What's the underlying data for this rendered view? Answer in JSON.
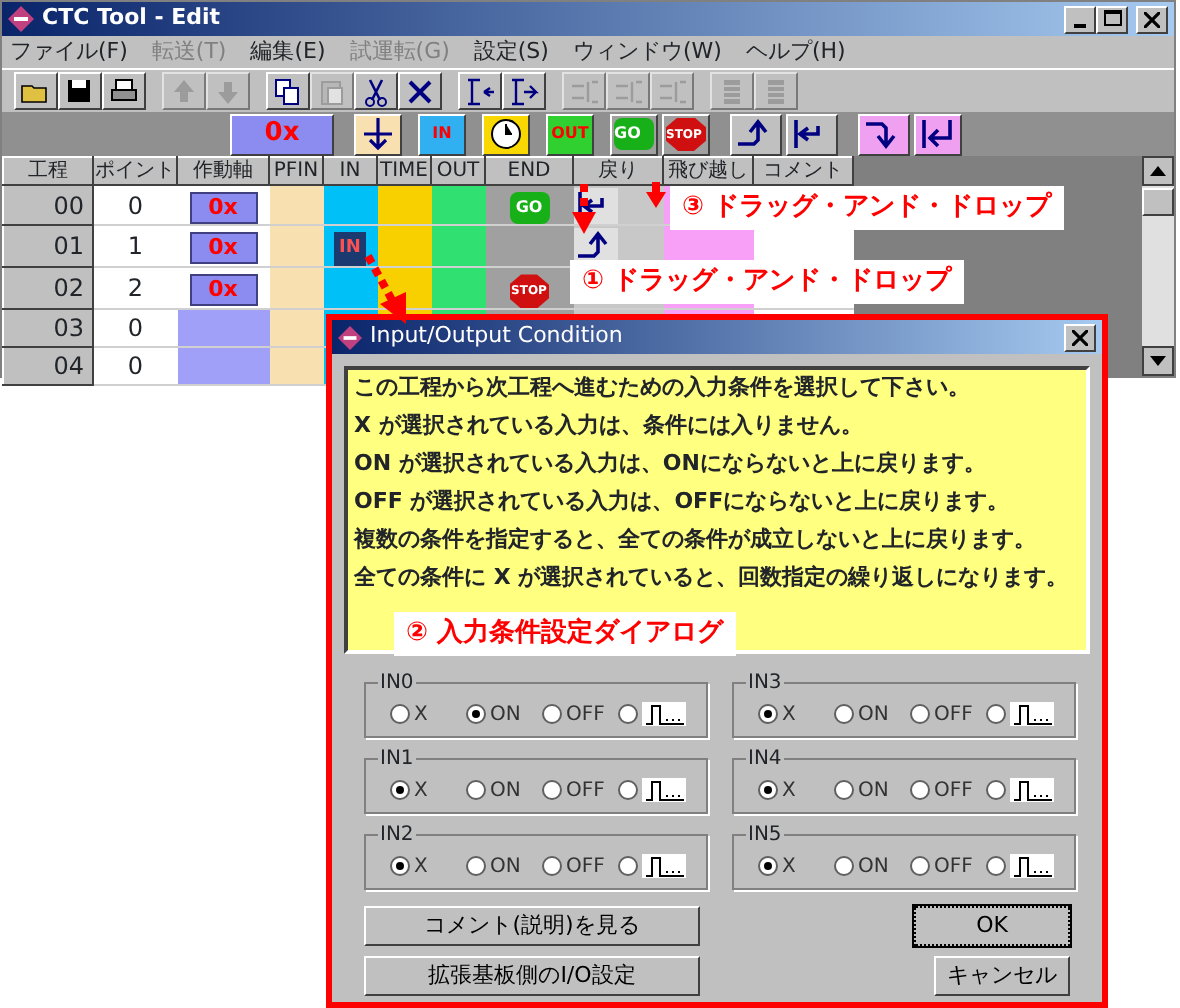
{
  "window": {
    "title": "CTC Tool - Edit"
  },
  "menu": [
    {
      "label": "ファイル(F)",
      "disabled": false
    },
    {
      "label": "転送(T)",
      "disabled": true
    },
    {
      "label": "編集(E)",
      "disabled": false
    },
    {
      "label": "試運転(G)",
      "disabled": true
    },
    {
      "label": "設定(S)",
      "disabled": false
    },
    {
      "label": "ウィンドウ(W)",
      "disabled": false
    },
    {
      "label": "ヘルプ(H)",
      "disabled": false
    }
  ],
  "toolbar": [
    [
      {
        "kind": "open",
        "disabled": false
      },
      {
        "kind": "save",
        "disabled": false
      },
      {
        "kind": "print",
        "disabled": false
      }
    ],
    [
      {
        "kind": "up",
        "disabled": true
      },
      {
        "kind": "down",
        "disabled": true
      }
    ],
    [
      {
        "kind": "copy",
        "disabled": false
      },
      {
        "kind": "paste",
        "disabled": true
      },
      {
        "kind": "cut",
        "disabled": false
      },
      {
        "kind": "delete",
        "disabled": false
      }
    ],
    [
      {
        "kind": "insert",
        "disabled": false
      },
      {
        "kind": "append",
        "disabled": false
      }
    ],
    [
      {
        "kind": "indent",
        "disabled": true
      },
      {
        "kind": "indent",
        "disabled": true
      },
      {
        "kind": "indent",
        "disabled": true
      }
    ],
    [
      {
        "kind": "bars",
        "disabled": true
      },
      {
        "kind": "bars",
        "disabled": true
      }
    ]
  ],
  "palette": [
    {
      "kind": "axis",
      "text": "0x"
    },
    {
      "kind": "pfin"
    },
    {
      "kind": "signal",
      "text": "IN"
    },
    {
      "kind": "timer"
    },
    {
      "kind": "out",
      "text": "OUT"
    },
    {
      "kind": "go",
      "text": "GO"
    },
    {
      "kind": "stop",
      "text": "STOP"
    },
    {
      "kind": "return-up"
    },
    {
      "kind": "return-left"
    },
    {
      "kind": "jump"
    },
    {
      "kind": "jump-back"
    }
  ],
  "grid": {
    "columns": [
      "工程",
      "ポイント",
      "作動軸",
      "PFIN",
      "IN",
      "TIME",
      "OUT",
      "END",
      "戻り",
      "飛び越し",
      "コメント"
    ],
    "rows": [
      {
        "step": "00",
        "point": "0",
        "axis": "0x",
        "end": {
          "kind": "go",
          "text": "GO"
        },
        "return": {
          "kind": "left"
        }
      },
      {
        "step": "01",
        "point": "1",
        "axis": "0x",
        "in": "IN",
        "return": {
          "kind": "up"
        }
      },
      {
        "step": "02",
        "point": "2",
        "axis": "0x",
        "end": {
          "kind": "stop",
          "text": "STOP"
        }
      },
      {
        "step": "03",
        "point": "0"
      },
      {
        "step": "04",
        "point": "0"
      }
    ]
  },
  "callouts": [
    {
      "text": "③ ドラッグ・アンド・ドロップ"
    },
    {
      "text": "① ドラッグ・アンド・ドロップ"
    },
    {
      "text": "② 入力条件設定ダイアログ"
    }
  ],
  "dialog": {
    "title": "Input/Output Condition",
    "lines": [
      "この工程から次工程へ進むための入力条件を選択して下さい。",
      "X が選択されている入力は、条件には入りません。",
      "ON が選択されている入力は、ONにならないと上に戻ります。",
      "OFF が選択されている入力は、OFFにならないと上に戻ります。",
      "複数の条件を指定すると、全ての条件が成立しないと上に戻ります。",
      "全ての条件に X が選択されていると、回数指定の繰り返しになります。"
    ],
    "groups": [
      {
        "label": "IN0",
        "options": [
          {
            "kind": "text",
            "label": "X",
            "selected": false
          },
          {
            "kind": "text",
            "label": "ON",
            "selected": true
          },
          {
            "kind": "text",
            "label": "OFF",
            "selected": false
          },
          {
            "kind": "pulse",
            "selected": false
          }
        ]
      },
      {
        "label": "IN3",
        "options": [
          {
            "kind": "text",
            "label": "X",
            "selected": true
          },
          {
            "kind": "text",
            "label": "ON",
            "selected": false
          },
          {
            "kind": "text",
            "label": "OFF",
            "selected": false
          },
          {
            "kind": "pulse",
            "selected": false
          }
        ]
      },
      {
        "label": "IN1",
        "options": [
          {
            "kind": "text",
            "label": "X",
            "selected": true
          },
          {
            "kind": "text",
            "label": "ON",
            "selected": false
          },
          {
            "kind": "text",
            "label": "OFF",
            "selected": false
          },
          {
            "kind": "pulse",
            "selected": false
          }
        ]
      },
      {
        "label": "IN4",
        "options": [
          {
            "kind": "text",
            "label": "X",
            "selected": true
          },
          {
            "kind": "text",
            "label": "ON",
            "selected": false
          },
          {
            "kind": "text",
            "label": "OFF",
            "selected": false
          },
          {
            "kind": "pulse",
            "selected": false
          }
        ]
      },
      {
        "label": "IN2",
        "options": [
          {
            "kind": "text",
            "label": "X",
            "selected": true
          },
          {
            "kind": "text",
            "label": "ON",
            "selected": false
          },
          {
            "kind": "text",
            "label": "OFF",
            "selected": false
          },
          {
            "kind": "pulse",
            "selected": false
          }
        ]
      },
      {
        "label": "IN5",
        "options": [
          {
            "kind": "text",
            "label": "X",
            "selected": true
          },
          {
            "kind": "text",
            "label": "ON",
            "selected": false
          },
          {
            "kind": "text",
            "label": "OFF",
            "selected": false
          },
          {
            "kind": "pulse",
            "selected": false
          }
        ]
      }
    ],
    "buttons": [
      {
        "label": "コメント(説明)を見る",
        "kind": "wide",
        "default": false
      },
      {
        "label": "OK",
        "kind": "narrow",
        "default": true
      },
      {
        "label": "拡張基板側のI/O設定",
        "kind": "wide",
        "default": false
      },
      {
        "label": "キャンセル",
        "kind": "narrow",
        "default": false
      }
    ]
  }
}
